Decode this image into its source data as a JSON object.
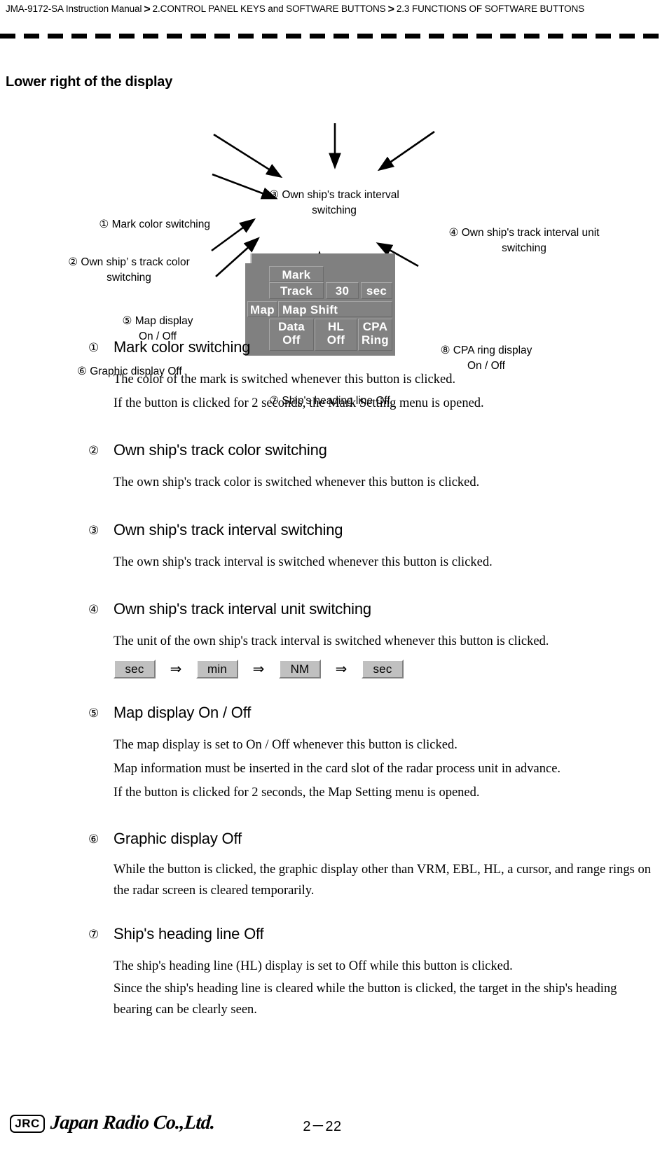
{
  "header": {
    "breadcrumb_1": "JMA-9172-SA Instruction Manual",
    "sep": ">",
    "breadcrumb_2": "2.CONTROL PANEL KEYS and SOFTWARE BUTTONS",
    "breadcrumb_3": "2.3  FUNCTIONS OF SOFTWARE BUTTONS"
  },
  "page_title": "Lower right of the display",
  "figure": {
    "callouts": [
      {
        "id": "1",
        "text": "① Mark color switching"
      },
      {
        "id": "2",
        "text": "② Own ship’ s track color\nswitching"
      },
      {
        "id": "3",
        "text": "③ Own ship's track interval\nswitching"
      },
      {
        "id": "4",
        "text": "④ Own ship's track interval unit\nswitching"
      },
      {
        "id": "5",
        "text": "⑤ Map display\nOn / Off"
      },
      {
        "id": "6",
        "text": "⑥ Graphic display Off"
      },
      {
        "id": "7",
        "text": "⑦ Ship's heading line Off"
      },
      {
        "id": "8",
        "text": "⑧ CPA ring display\nOn / Off"
      }
    ],
    "panel_buttons": {
      "mark": "Mark",
      "track": "Track",
      "interval": "30",
      "unit": "sec",
      "map": "Map",
      "map_shift": "Map  Shift",
      "data_line1": "Data",
      "data_line2": "Off",
      "hl_line1": "HL",
      "hl_line2": "Off",
      "cpa_line1": "CPA",
      "cpa_line2": "Ring"
    }
  },
  "items": [
    {
      "num": "①",
      "heading": "Mark color switching",
      "paragraphs": [
        "The color of the mark is switched whenever this button is clicked.",
        "If the button is clicked for 2 seconds, the Mark Setting menu is opened."
      ]
    },
    {
      "num": "②",
      "heading": "Own ship's track color switching",
      "paragraphs": [
        "The own ship's track color is switched whenever this button is clicked."
      ]
    },
    {
      "num": "③",
      "heading": "Own ship's track interval switching",
      "paragraphs": [
        "The own ship's track interval is switched whenever this button is clicked."
      ]
    },
    {
      "num": "④",
      "heading": "Own ship's track interval unit switching",
      "paragraphs": [
        "The unit of the own ship's track interval is switched whenever this button is clicked."
      ]
    },
    {
      "num": "⑤",
      "heading": "Map display On / Off",
      "paragraphs": [
        "The map display is set to On / Off whenever this button is clicked.",
        "Map information must be inserted in the card slot of the radar process unit in advance.",
        "If the button is clicked for 2 seconds, the Map Setting menu is opened."
      ]
    },
    {
      "num": "⑥",
      "heading": "Graphic display Off",
      "paragraphs": [
        "While the button is clicked, the graphic display other than VRM, EBL, HL, a cursor, and range rings on the radar screen is cleared temporarily."
      ]
    },
    {
      "num": "⑦",
      "heading": "Ship's heading line Off",
      "paragraphs": [
        "The ship's heading line (HL) display is set to Off while this button is clicked.",
        "Since the ship's heading line is cleared while the button is clicked, the target in the ship's heading bearing can be clearly seen."
      ]
    }
  ],
  "unit_sequence": {
    "steps": [
      "sec",
      "min",
      "NM",
      "sec"
    ],
    "arrow": "⇒"
  },
  "footer": {
    "logo_mark": "JRC",
    "company": "Japan Radio Co.,Ltd.",
    "page_number": "2－22"
  },
  "colors": {
    "panel_bg": "#808080",
    "panel_button": "#828282",
    "panel_text": "#ffffff",
    "seq_button": "#c0c0c0",
    "text": "#000000"
  }
}
